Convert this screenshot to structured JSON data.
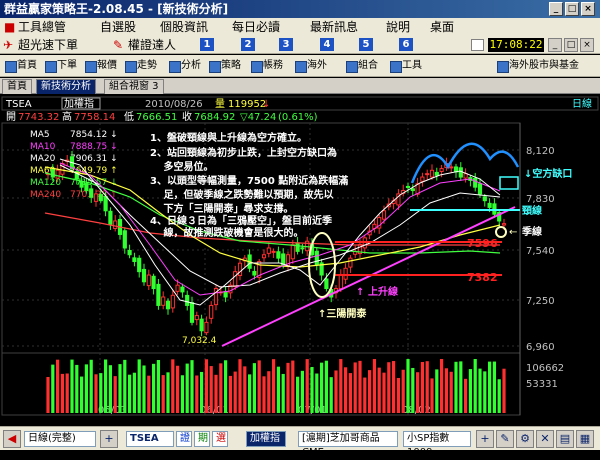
{
  "window": {
    "title": "群益贏家策略王-2.08.45 - [新技術分析]"
  },
  "menu": {
    "items": [
      "工具總管",
      "自選股",
      "個股資訊",
      "每日必讀",
      "最新訊息",
      "說明",
      "桌面"
    ]
  },
  "quickbar": {
    "item1": "超光速下單",
    "item2": "權證達人",
    "nums": [
      "1",
      "2",
      "3",
      "4",
      "5",
      "6"
    ]
  },
  "clock": "17:08:22",
  "toolbar": {
    "items": [
      "首頁",
      "下單",
      "報價",
      "走勢",
      "分析",
      "策略",
      "帳務",
      "海外",
      "組合",
      "工具"
    ],
    "right_link": "海外股市與基金"
  },
  "tabs": {
    "items": [
      "首頁",
      "新技術分析",
      "組合視窗 3"
    ]
  },
  "chart_header": {
    "symbol": "TSEA",
    "name": "加權指",
    "date": "2010/08/26",
    "volume_label": "量",
    "volume": "119952",
    "open_label": "開",
    "open": "7743.32",
    "high_label": "高",
    "high": "7758.14",
    "low_label": "低",
    "low": "7666.51",
    "close_label": "收",
    "close": "7684.92",
    "change": "▽47.24",
    "pct": "(0.61%)",
    "period": "日線"
  },
  "ma_legend": [
    {
      "name": "MA5",
      "value": "7854.12",
      "arrow": "↓",
      "color": "#ffffff"
    },
    {
      "name": "MA10",
      "value": "7888.75",
      "arrow": "↓",
      "color": "#ff40ff"
    },
    {
      "name": "MA20",
      "value": "7906.31",
      "arrow": "↓",
      "color": "#ffffff"
    },
    {
      "name": "MA60",
      "value": "7649.79",
      "arrow": "↑",
      "color": "#ffff40"
    },
    {
      "name": "MA120",
      "value": "7715.57",
      "arrow": "↓",
      "color": "#40ff40"
    },
    {
      "name": "MA240",
      "value": "7703.28",
      "arrow": "↑",
      "color": "#ff4040"
    }
  ],
  "annotations": {
    "lines": [
      "1、盤破頸線與上升線為空方確立。",
      "2、站回頸線為初步止跌，上封空方缺口為",
      "　 多空易位。",
      "3、以頭型等幅測量，7500 點附近為跌幅滿",
      "　 足，但破季線之跌勢難以預期，故先以",
      "　 下方「三陽開泰」尋求支撐。",
      "4、日線３日為「三鴉壓空」，盤目前近季",
      "　 線，故推測跌破機會是很大的。"
    ],
    "gap": "↓空方缺口",
    "neckline": "頸線",
    "season_line": "季線",
    "uptrend": "上升線",
    "three_soldiers": "↑三陽開泰",
    "level_7596": "7596",
    "level_7382": "7382",
    "low_mark": "7,032.4",
    "arrow_season": "←"
  },
  "y_axis": {
    "price_ticks": [
      "8,120",
      "7,830",
      "7,540",
      "7,250",
      "6,960"
    ],
    "volume_ticks": [
      "106662",
      "53331"
    ]
  },
  "x_axis": {
    "ticks": [
      "05/03",
      "06/01",
      "07/01",
      "08/02"
    ]
  },
  "chart_data": {
    "type": "candlestick",
    "x": [
      "2010-04-26",
      "2010-08-26"
    ],
    "ylim": [
      6960,
      8180
    ],
    "last_close": 7684.92,
    "last_open": 7743.32,
    "last_high": 7758.14,
    "last_low": 7666.51,
    "period_low": 7032.4,
    "levels": [
      7596,
      7382
    ]
  },
  "statusbar": {
    "period": "日線(完整)",
    "symbol": "TSEA",
    "b1": "證",
    "b2": "期",
    "b3": "選",
    "name": "加權指",
    "product": "[滬期]芝加哥商品CME",
    "index": "小SP指數1009"
  }
}
